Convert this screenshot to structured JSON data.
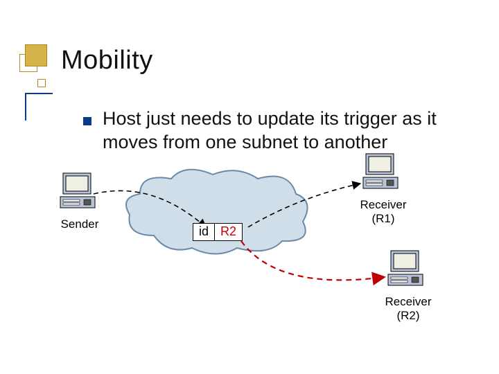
{
  "title": "Mobility",
  "bullet_text": "Host just needs to update its trigger as it moves from one subnet to another",
  "sender_label": "Sender",
  "receiver1_label": "Receiver\n(R1)",
  "receiver2_label": "Receiver\n(R2)",
  "trigger": {
    "id_label": "id",
    "addr_label": "R2"
  }
}
